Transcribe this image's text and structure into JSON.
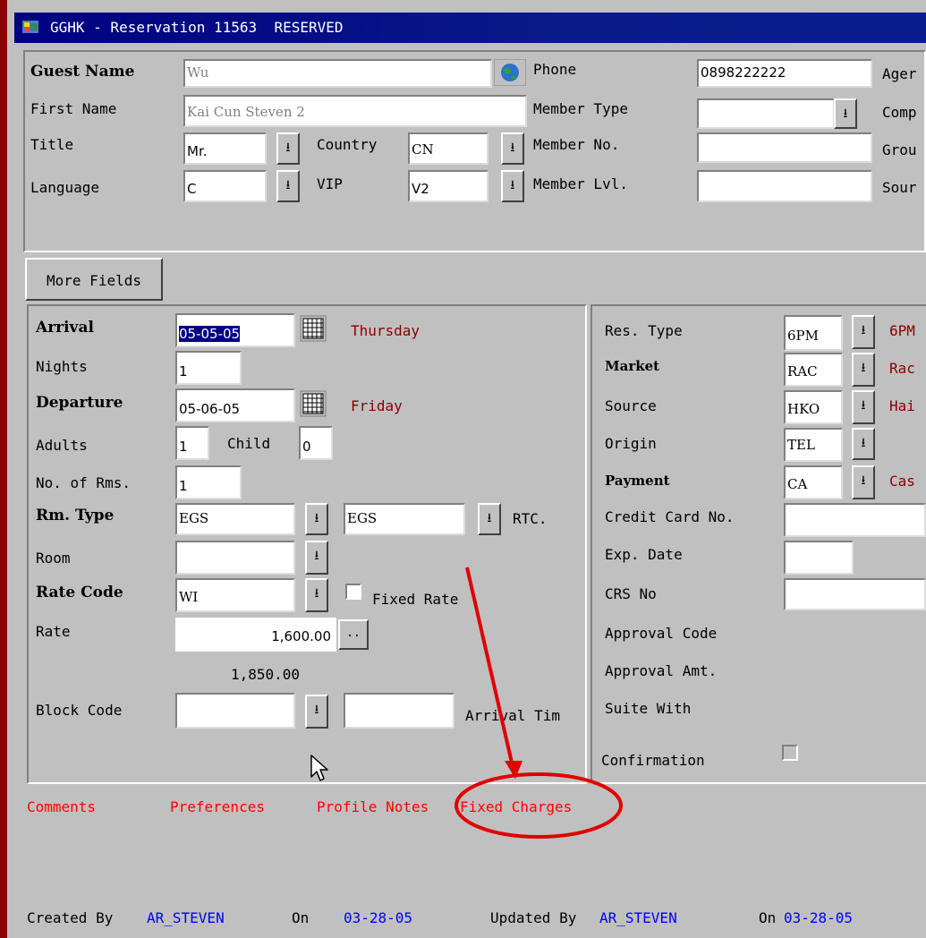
{
  "window": {
    "title": "GGHK - Reservation 11563  RESERVED"
  },
  "guest": {
    "guest_name_label": "Guest Name",
    "guest_name_value": "Wu",
    "first_name_label": "First Name",
    "first_name_value": "Kai Cun Steven 2",
    "title_label": "Title",
    "title_value": "Mr.",
    "country_label": "Country",
    "country_value": "CN",
    "language_label": "Language",
    "language_value": "C",
    "vip_label": "VIP",
    "vip_value": "V2",
    "phone_label": "Phone",
    "phone_value": "0898222222",
    "member_type_label": "Member Type",
    "member_type_value": "",
    "member_no_label": "Member No.",
    "member_no_value": "",
    "member_lvl_label": "Member Lvl.",
    "member_lvl_value": "",
    "agent_label": "Ager",
    "company_label": "Comp",
    "group_label": "Grou",
    "source_label": "Sour"
  },
  "more_fields_label": "More Fields",
  "stay": {
    "arrival_label": "Arrival",
    "arrival_value": "05-05-05",
    "arrival_day": "Thursday",
    "nights_label": "Nights",
    "nights_value": "1",
    "departure_label": "Departure",
    "departure_value": "05-06-05",
    "departure_day": "Friday",
    "adults_label": "Adults",
    "adults_value": "1",
    "child_label": "Child",
    "child_value": "0",
    "rooms_label": "No. of Rms.",
    "rooms_value": "1",
    "rm_type_label": "Rm. Type",
    "rm_type_value": "EGS",
    "rtc_value": "EGS",
    "rtc_label": "RTC.",
    "room_label": "Room",
    "room_value": "",
    "rate_code_label": "Rate Code",
    "rate_code_value": "WI",
    "fixed_rate_label": "Fixed Rate",
    "rate_label": "Rate",
    "rate_value": "1,600.00",
    "rate_btn": "..",
    "rate_alt": "1,850.00",
    "block_code_label": "Block Code",
    "block_code_value": "",
    "arrival_time_label": "Arrival Tim"
  },
  "billing": {
    "res_type_label": "Res. Type",
    "res_type_value": "6PM",
    "res_type_desc": "6PM",
    "market_label": "Market",
    "market_value": "RAC",
    "market_desc": "Rac",
    "source_label": "Source",
    "source_value": "HKO",
    "source_desc": "Hai",
    "origin_label": "Origin",
    "origin_value": "TEL",
    "payment_label": "Payment",
    "payment_value": "CA",
    "payment_desc": "Cas",
    "cc_label": "Credit Card No.",
    "exp_label": "Exp. Date",
    "crs_label": "CRS No",
    "approval_code_label": "Approval Code",
    "approval_amt_label": "Approval Amt.",
    "suite_with_label": "Suite With",
    "confirmation_label": "Confirmation"
  },
  "links": {
    "comments": "Comments",
    "preferences": "Preferences",
    "profile_notes": "Profile Notes",
    "fixed_charges": "Fixed Charges"
  },
  "footer": {
    "created_by_label": "Created By",
    "created_by_value": "AR_STEVEN",
    "created_on_label": "On",
    "created_on_value": "03-28-05",
    "updated_by_label": "Updated By",
    "updated_by_value": "AR_STEVEN",
    "updated_on_label": "On",
    "updated_on_value": "03-28-05"
  },
  "colors": {
    "titlebar": "#000080",
    "annotation": "#e00000",
    "day_text": "#8b0000",
    "link_text": "#ff0000",
    "footer_value": "#0000ff"
  },
  "icons": {
    "app": "app-icon",
    "globe": "globe-icon",
    "calendar": "calendar-icon",
    "dropdown": "dropdown-arrow-icon",
    "cursor": "mouse-cursor-icon"
  }
}
